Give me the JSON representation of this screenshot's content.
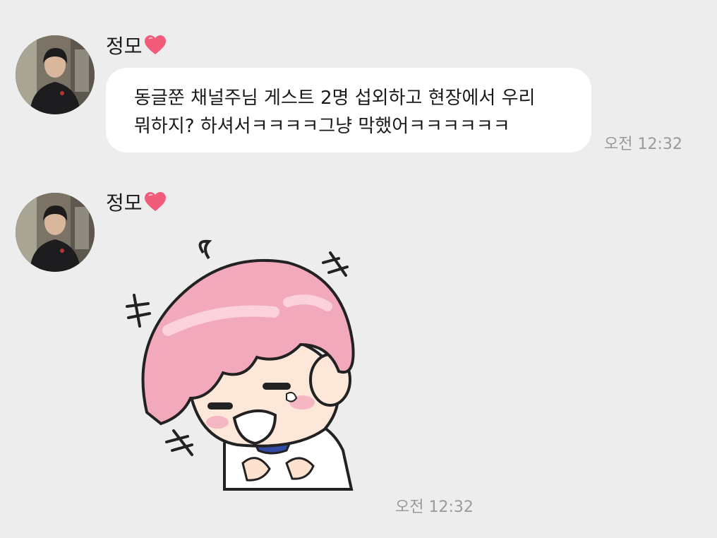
{
  "messages": [
    {
      "sender": "정모",
      "text_lines": [
        "동글쭌 채널주님 게스트 2명 섭외하고 현장에서 우리",
        "뭐하지? 하셔서ㅋㅋㅋㅋ그냥 막했어ㅋㅋㅋㅋㅋㅋ"
      ],
      "time": "오전 12:32"
    },
    {
      "sender": "정모",
      "sticker": "pink-hair-boy-laughing-sticker",
      "time": "오전 12:32"
    }
  ],
  "colors": {
    "background": "#ededed",
    "bubble": "#ffffff",
    "heart": "#f25b7a",
    "timestamp": "#9a9a9a",
    "sticker_hair": "#f2a9bc"
  },
  "icons": {
    "heart": "heart-icon",
    "avatar": "profile-photo"
  }
}
